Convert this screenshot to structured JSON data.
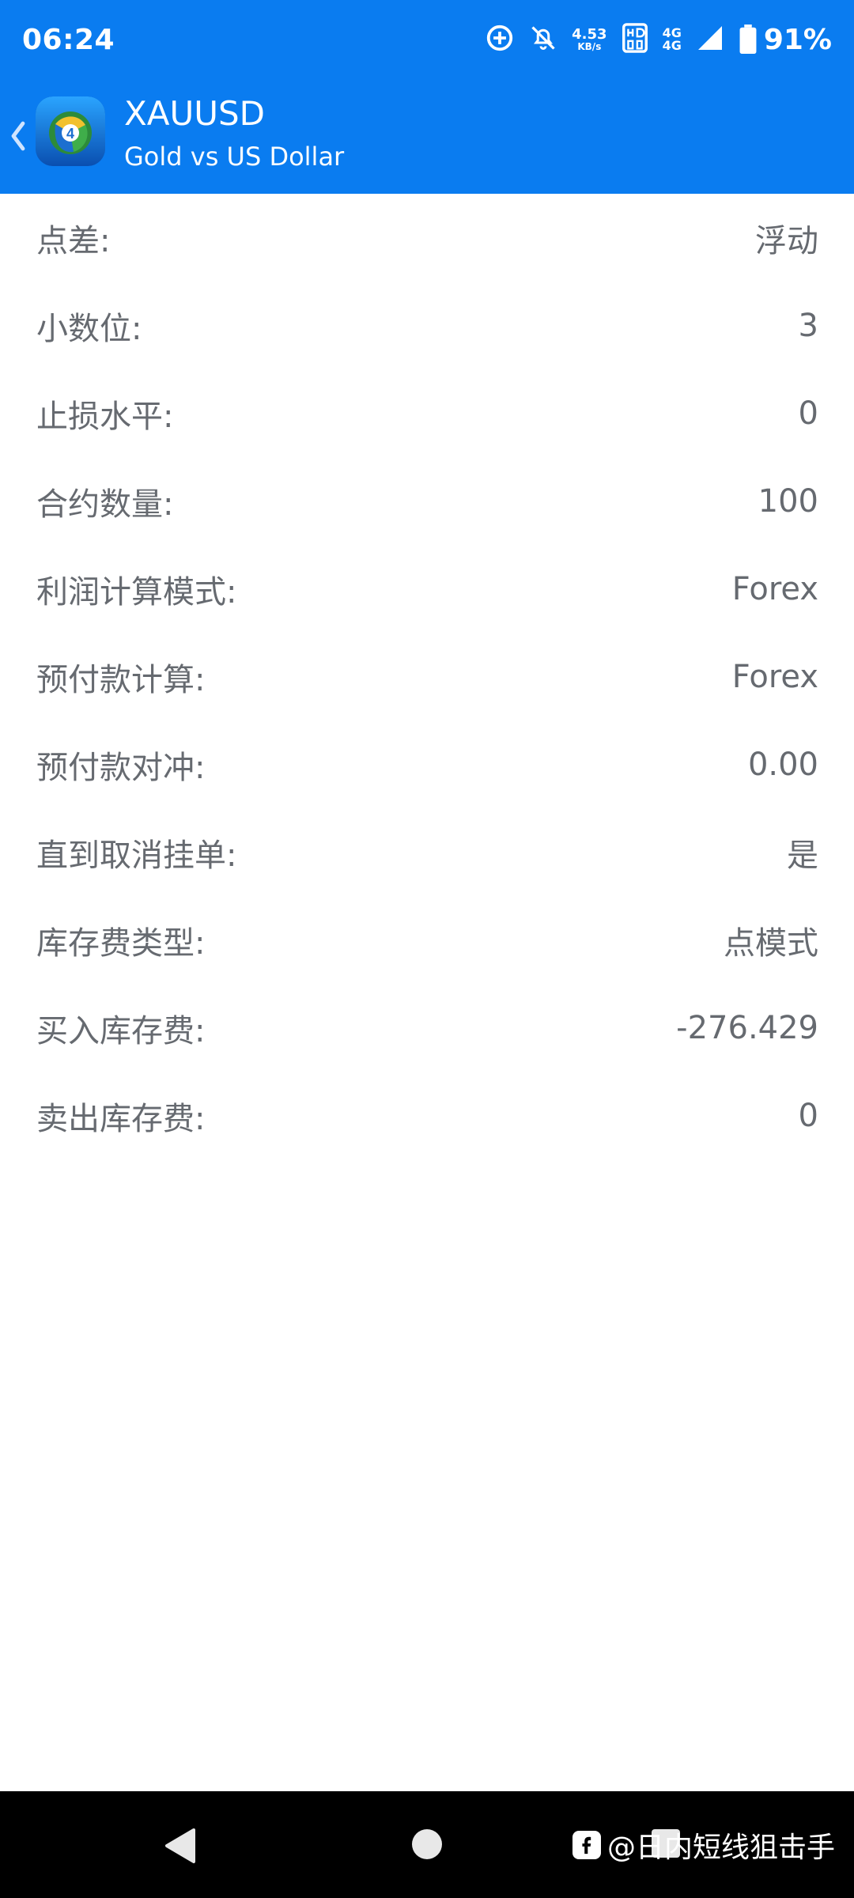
{
  "status_bar": {
    "time": "06:24",
    "speed_value": "4.53",
    "speed_unit": "KB/s",
    "network_top": "4G",
    "network_bottom": "4G",
    "battery": "91%"
  },
  "header": {
    "title": "XAUUSD",
    "subtitle": "Gold vs US Dollar",
    "back_icon": "chevron-left-icon",
    "logo_icon": "metatrader-app-icon"
  },
  "specs": [
    {
      "label": "点差:",
      "value": "浮动"
    },
    {
      "label": "小数位:",
      "value": "3"
    },
    {
      "label": "止损水平:",
      "value": "0"
    },
    {
      "label": "合约数量:",
      "value": "100"
    },
    {
      "label": "利润计算模式:",
      "value": "Forex"
    },
    {
      "label": "预付款计算:",
      "value": "Forex"
    },
    {
      "label": "预付款对冲:",
      "value": "0.00"
    },
    {
      "label": "直到取消挂单:",
      "value": "是"
    },
    {
      "label": "库存费类型:",
      "value": "点模式"
    },
    {
      "label": "买入库存费:",
      "value": "-276.429"
    },
    {
      "label": "卖出库存费:",
      "value": "0"
    }
  ],
  "watermark": {
    "text": "@日内短线狙击手"
  },
  "colors": {
    "primary": "#0a7cf0",
    "text_muted": "#666a70",
    "navbar": "#000000"
  }
}
